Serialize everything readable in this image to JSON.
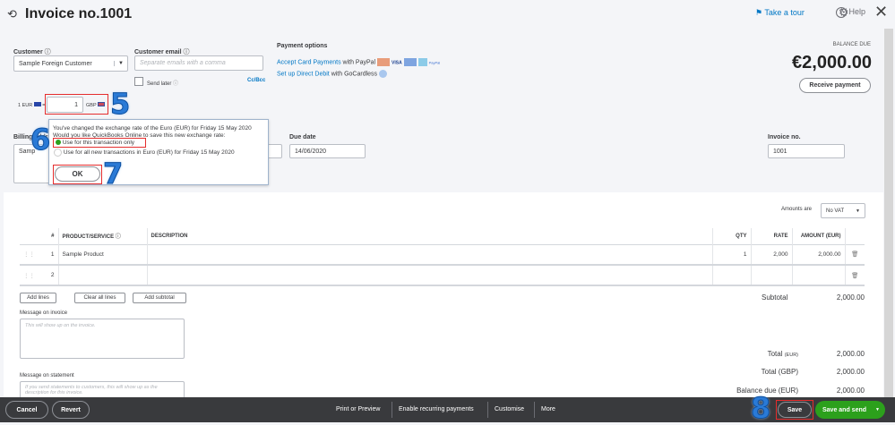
{
  "header": {
    "title": "Invoice no.1001",
    "take_tour": "Take a tour",
    "help": "Help"
  },
  "customer": {
    "label": "Customer",
    "value": "Sample  Foreign Customer"
  },
  "email": {
    "label": "Customer email",
    "placeholder": "Separate emails with a comma",
    "send_later": "Send later",
    "cc_bcc": "Cc/Bcc"
  },
  "payment": {
    "label": "Payment options",
    "card_link": "Accept Card Payments",
    "card_suffix": " with PayPal",
    "card_logos": [
      "MC",
      "VISA",
      "MAESTRO",
      "AMEX",
      "PayPal"
    ],
    "dd_link": "Set up Direct Debit",
    "dd_suffix": " with GoCardless"
  },
  "balance": {
    "label": "BALANCE DUE",
    "amount": "€2,000.00",
    "receive": "Receive payment"
  },
  "exchange": {
    "prefix": "1 EUR",
    "eq": "=",
    "value": "1",
    "suffix": "GBP"
  },
  "popup": {
    "line1": "You've changed the exchange rate of the Euro (EUR) for Friday 15 May 2020",
    "line2": "Would you like QuickBooks Online to save this new exchange rate:",
    "option1": "Use for this transaction only",
    "option2": "Use for all new transactions in Euro (EUR) for Friday 15 May 2020",
    "ok": "OK"
  },
  "annotations": {
    "n5": "5",
    "n6": "6",
    "n7": "7",
    "n8": "8"
  },
  "billing": {
    "label": "Billing address",
    "value": "Samp"
  },
  "due": {
    "label": "Due date",
    "value": "14/06/2020"
  },
  "invoice_no": {
    "label": "Invoice no.",
    "value": "1001"
  },
  "amounts": {
    "label": "Amounts are",
    "value": "No VAT"
  },
  "table": {
    "headers": [
      "#",
      "PRODUCT/SERVICE",
      "DESCRIPTION",
      "QTY",
      "RATE",
      "AMOUNT (EUR)"
    ],
    "rows": [
      {
        "n": "1",
        "product": "Sample Product",
        "desc": "",
        "qty": "1",
        "rate": "2,000",
        "amount": "2,000.00"
      },
      {
        "n": "2",
        "product": "",
        "desc": "",
        "qty": "",
        "rate": "",
        "amount": ""
      }
    ]
  },
  "actions": {
    "add_lines": "Add lines",
    "clear": "Clear all lines",
    "add_subtotal": "Add subtotal"
  },
  "totals": {
    "subtotal_label": "Subtotal",
    "subtotal": "2,000.00",
    "total_eur_label": "Total",
    "total_eur_unit": "(EUR)",
    "total_eur": "2,000.00",
    "total_gbp_label": "Total (GBP)",
    "total_gbp": "2,000.00",
    "balance_label": "Balance due (EUR)",
    "balance": "2,000.00"
  },
  "messages": {
    "invoice_label": "Message on invoice",
    "invoice_placeholder": "This will show up on the invoice.",
    "statement_label": "Message on statement",
    "statement_placeholder": "If you send statements to customers, this will show up as the description for this invoice."
  },
  "footer": {
    "cancel": "Cancel",
    "revert": "Revert",
    "print": "Print or Preview",
    "recurring": "Enable recurring payments",
    "customise": "Customise",
    "more": "More",
    "save": "Save",
    "save_send": "Save and send"
  }
}
